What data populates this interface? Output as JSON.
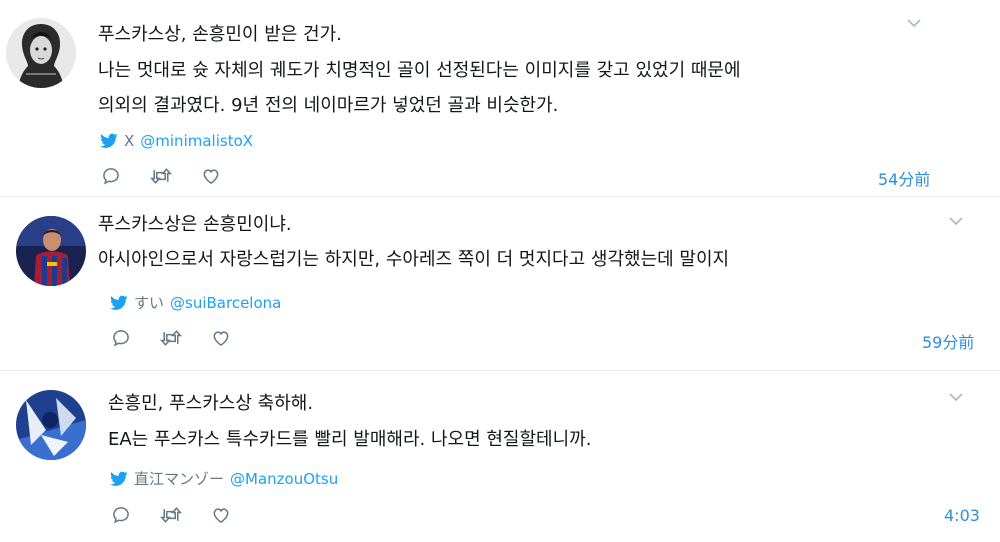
{
  "tweets": [
    {
      "lines": [
        "푸스카스상, 손흥민이 받은 건가.",
        "나는 멋대로 슛 자체의 궤도가 치명적인 골이 선정된다는 이미지를 갖고 있었기 때문에",
        "의외의 결과였다. 9년 전의 네이마르가 넣었던 골과 비슷한가."
      ],
      "source": "X",
      "handle": "@minimalistoX",
      "time": "54分前",
      "avatar_icon": "avatar-sketch-portrait"
    },
    {
      "lines": [
        "푸스카스상은 손흥민이냐.",
        "아시아인으로서 자랑스럽기는 하지만, 수아레즈 쪽이 더 멋지다고 생각했는데 말이지"
      ],
      "source": "すい",
      "handle": "@suiBarcelona",
      "time": "59分前",
      "avatar_icon": "avatar-barcelona-player"
    },
    {
      "lines": [
        "손흥민, 푸스카스상 축하해.",
        "EA는 푸스카스 특수카드를 빨리 발매해라. 나오면 현질할테니까."
      ],
      "source": "直江マンゾー",
      "handle": "@ManzouOtsu",
      "time": "4:03",
      "avatar_icon": "avatar-anime-character"
    }
  ],
  "colors": {
    "text": "#14171a",
    "link": "#1da1f2",
    "muted": "#657786",
    "time": "#2f8fd8",
    "separator": "#e6ecf0"
  },
  "icons": [
    "twitter-bird-icon",
    "reply-icon",
    "retweet-icon",
    "like-icon",
    "chevron-down-icon"
  ]
}
